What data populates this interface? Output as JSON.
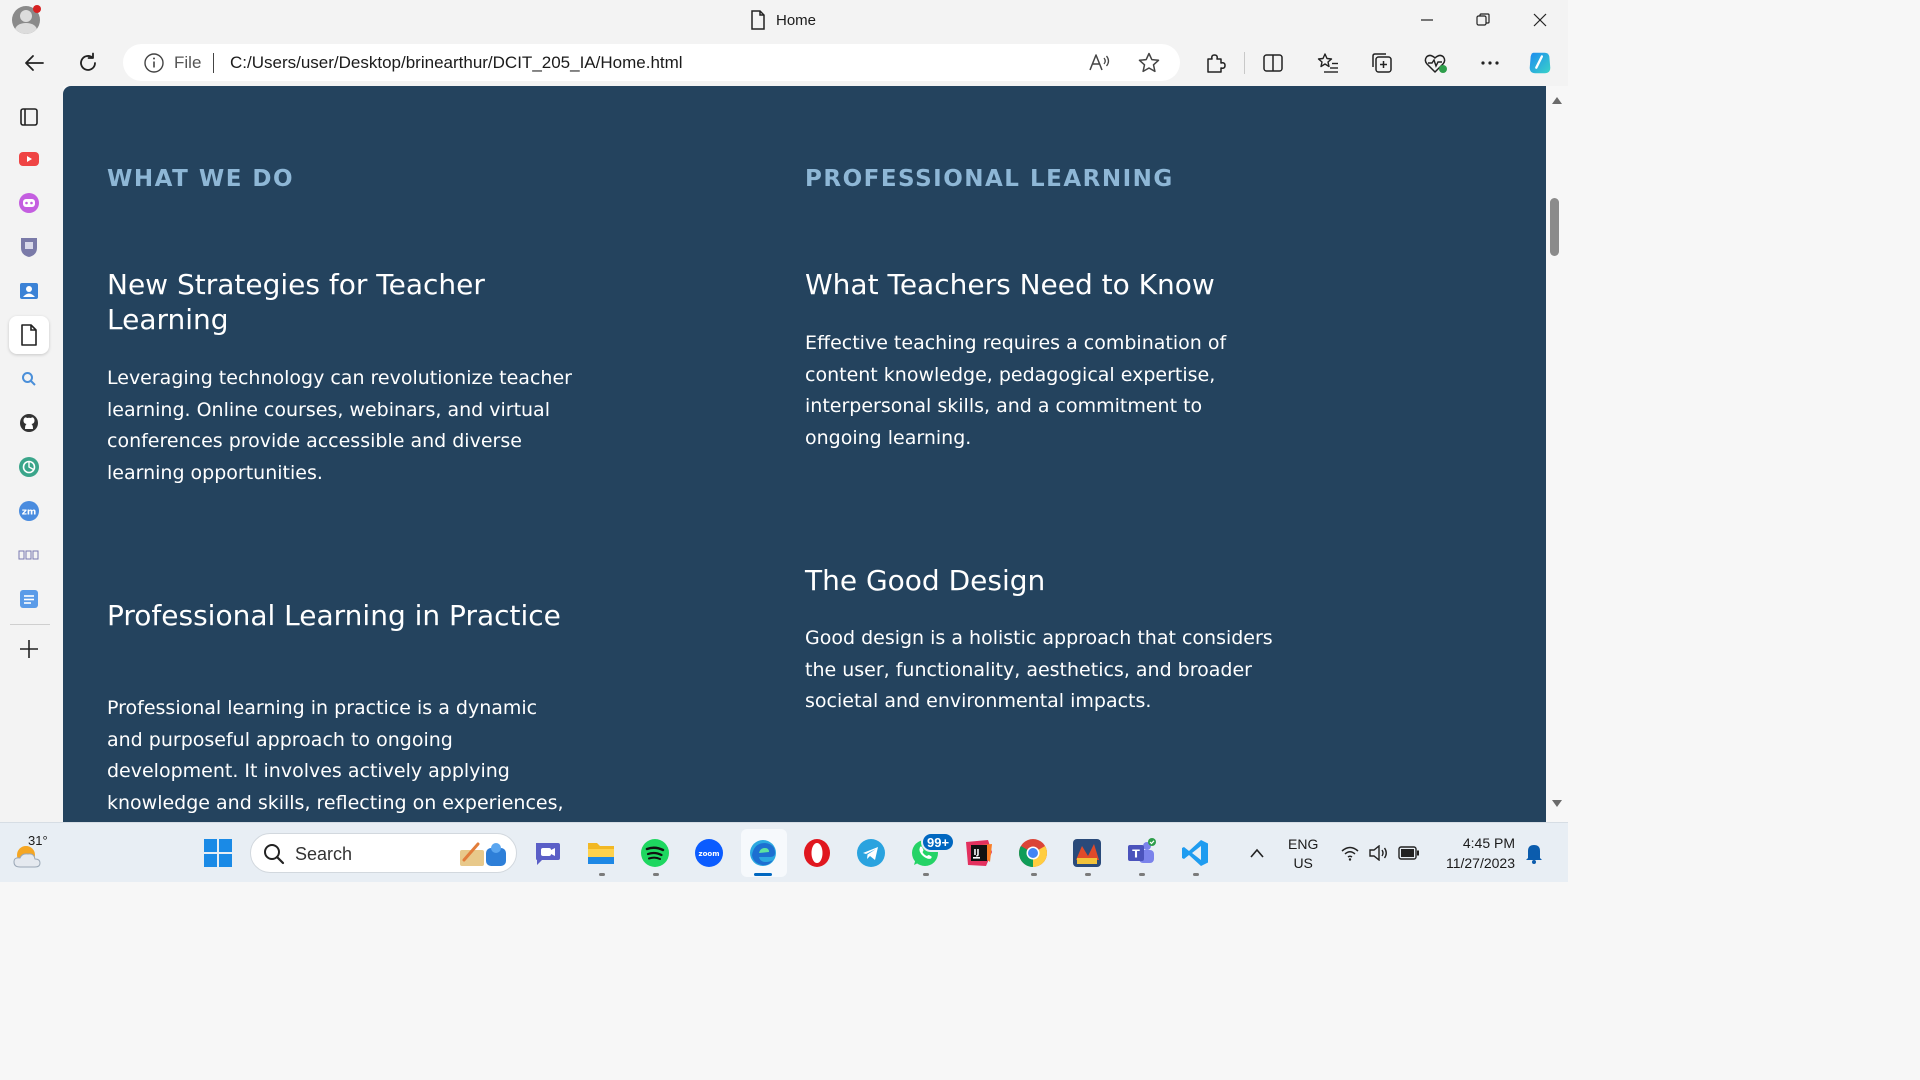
{
  "browser": {
    "tab_title": "Home",
    "address_prefix": "File",
    "url": "C:/Users/user/Desktop/brinearthur/DCIT_205_IA/Home.html"
  },
  "page": {
    "left_column": {
      "heading": "WHAT WE DO",
      "cards": [
        {
          "title": "New Strategies for Teacher Learning",
          "text": "Leveraging technology can revolutionize teacher learning. Online courses, webinars, and virtual conferences provide accessible and diverse learning opportunities."
        },
        {
          "title": "Professional Learning in Practice",
          "text": "Professional learning in practice is a dynamic and purposeful approach to ongoing development. It involves actively applying knowledge and skills, reflecting on experiences, collaborating with peers,"
        }
      ]
    },
    "right_column": {
      "heading": "PROFESSIONAL LEARNING",
      "cards": [
        {
          "title": "What Teachers Need to Know",
          "text": "Effective teaching requires a combination of content knowledge, pedagogical expertise, interpersonal skills, and a commitment to ongoing learning."
        },
        {
          "title": "The Good Design",
          "text": "Good design is a holistic approach that considers the user, functionality, aesthetics, and broader societal and environmental impacts."
        }
      ]
    }
  },
  "taskbar": {
    "weather_temp": "31°",
    "search_label": "Search",
    "whatsapp_badge": "99+",
    "language": "ENG",
    "region": "US",
    "time": "4:45 PM",
    "date": "11/27/2023"
  },
  "colors": {
    "content_bg": "#24435e",
    "heading_accent": "#8eb7d6",
    "text": "#ffffff"
  }
}
